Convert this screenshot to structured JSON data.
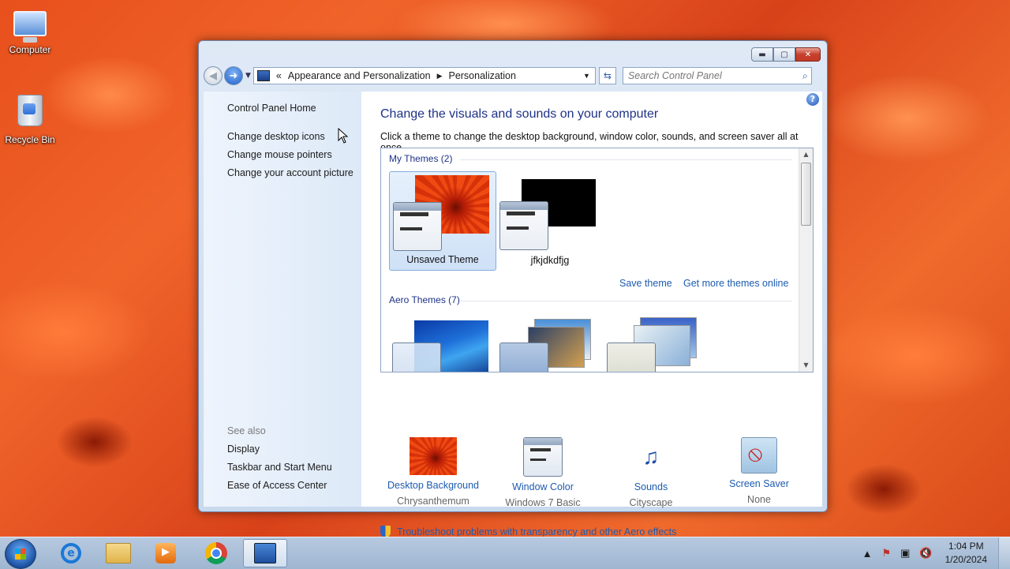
{
  "desktop": {
    "icons": [
      {
        "label": "Computer",
        "icon": "computer-icon"
      },
      {
        "label": "Recycle Bin",
        "icon": "recycle-bin-icon"
      }
    ]
  },
  "window": {
    "address": {
      "prefix": "«",
      "parts": [
        "Appearance and Personalization",
        "Personalization"
      ]
    },
    "search_placeholder": "Search Control Panel",
    "help": "?"
  },
  "sidebar": {
    "home": "Control Panel Home",
    "links": [
      "Change desktop icons",
      "Change mouse pointers",
      "Change your account picture"
    ],
    "see_also_label": "See also",
    "see_also": [
      "Display",
      "Taskbar and Start Menu",
      "Ease of Access Center"
    ]
  },
  "main": {
    "title": "Change the visuals and sounds on your computer",
    "subtitle": "Click a theme to change the desktop background, window color, sounds, and screen saver all at once.",
    "my_themes_header": "My Themes (2)",
    "my_themes": [
      {
        "name": "Unsaved Theme",
        "selected": true
      },
      {
        "name": "jfkjdkdfjg",
        "selected": false
      }
    ],
    "save_theme": "Save theme",
    "get_more": "Get more themes online",
    "aero_header": "Aero Themes (7)"
  },
  "bottom": [
    {
      "label": "Desktop Background",
      "value": "Chrysanthemum",
      "icon": "desktop-background-icon"
    },
    {
      "label": "Window Color",
      "value": "Windows 7 Basic",
      "icon": "window-color-icon"
    },
    {
      "label": "Sounds",
      "value": "Cityscape",
      "icon": "sounds-icon"
    },
    {
      "label": "Screen Saver",
      "value": "None",
      "icon": "screen-saver-icon"
    }
  ],
  "troubleshoot": "Troubleshoot problems with transparency and other Aero effects",
  "taskbar": {
    "time": "1:04 PM",
    "date": "1/20/2024",
    "apps": [
      "internet-explorer",
      "file-explorer",
      "media-player",
      "chrome",
      "control-panel"
    ]
  }
}
